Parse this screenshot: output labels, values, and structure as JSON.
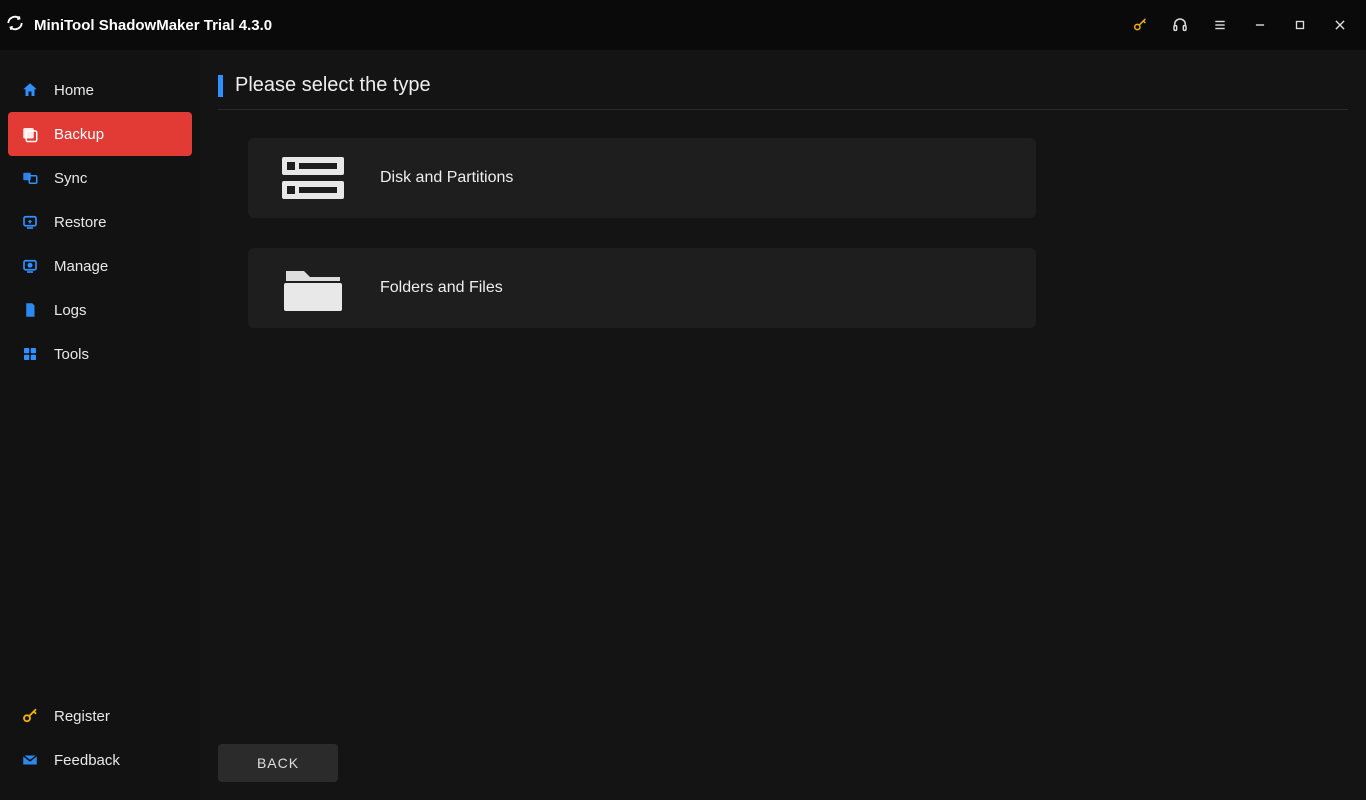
{
  "app": {
    "title": "MiniTool ShadowMaker Trial 4.3.0"
  },
  "sidebar": {
    "items": [
      {
        "label": "Home"
      },
      {
        "label": "Backup"
      },
      {
        "label": "Sync"
      },
      {
        "label": "Restore"
      },
      {
        "label": "Manage"
      },
      {
        "label": "Logs"
      },
      {
        "label": "Tools"
      }
    ],
    "bottom": [
      {
        "label": "Register"
      },
      {
        "label": "Feedback"
      }
    ]
  },
  "main": {
    "heading": "Please select the type",
    "options": [
      {
        "label": "Disk and Partitions"
      },
      {
        "label": "Folders and Files"
      }
    ],
    "back_label": "BACK"
  }
}
